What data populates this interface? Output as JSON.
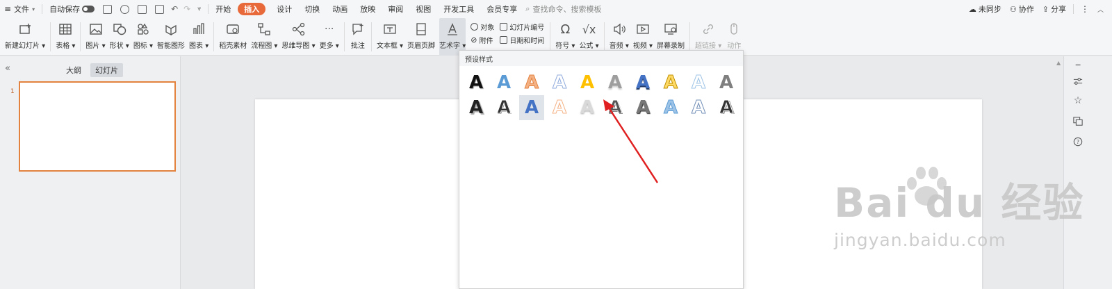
{
  "menubar": {
    "file_label": "文件",
    "autosave_label": "自动保存",
    "tabs": [
      {
        "label": "开始"
      },
      {
        "label": "插入",
        "active": true
      },
      {
        "label": "设计"
      },
      {
        "label": "切换"
      },
      {
        "label": "动画"
      },
      {
        "label": "放映"
      },
      {
        "label": "审阅"
      },
      {
        "label": "视图"
      },
      {
        "label": "开发工具"
      },
      {
        "label": "会员专享"
      }
    ],
    "search_placeholder": "查找命令、搜索模板",
    "right": {
      "sync": "未同步",
      "collab": "协作",
      "share": "分享"
    }
  },
  "ribbon": {
    "new_slide": "新建幻灯片",
    "table": "表格",
    "picture": "图片",
    "shape": "形状",
    "icon": "图标",
    "smartart": "智能图形",
    "chart": "图表",
    "material": "稻壳素材",
    "flowchart": "流程图",
    "mindmap": "思维导图",
    "more": "更多",
    "comment": "批注",
    "textbox": "文本框",
    "header_footer": "页眉页脚",
    "wordart": "艺术字",
    "object": "对象",
    "attachment": "附件",
    "slide_number": "幻灯片编号",
    "datetime": "日期和时间",
    "symbol": "符号",
    "formula": "公式",
    "audio": "音频",
    "video": "视频",
    "screen_record": "屏幕录制",
    "hyperlink": "超链接",
    "action": "动作"
  },
  "left_panel": {
    "tabs": [
      "大纲",
      "幻灯片"
    ],
    "slide_number": "1"
  },
  "popup": {
    "title": "预设样式",
    "glyph": "A",
    "styles_count": 20,
    "selected_index": 12
  },
  "watermark": {
    "brand": "Bai du 经验",
    "url": "jingyan.baidu.com"
  },
  "colors": {
    "accent_tab": "#e8693a",
    "slide_border": "#e3823f",
    "arrow": "#e02020"
  }
}
